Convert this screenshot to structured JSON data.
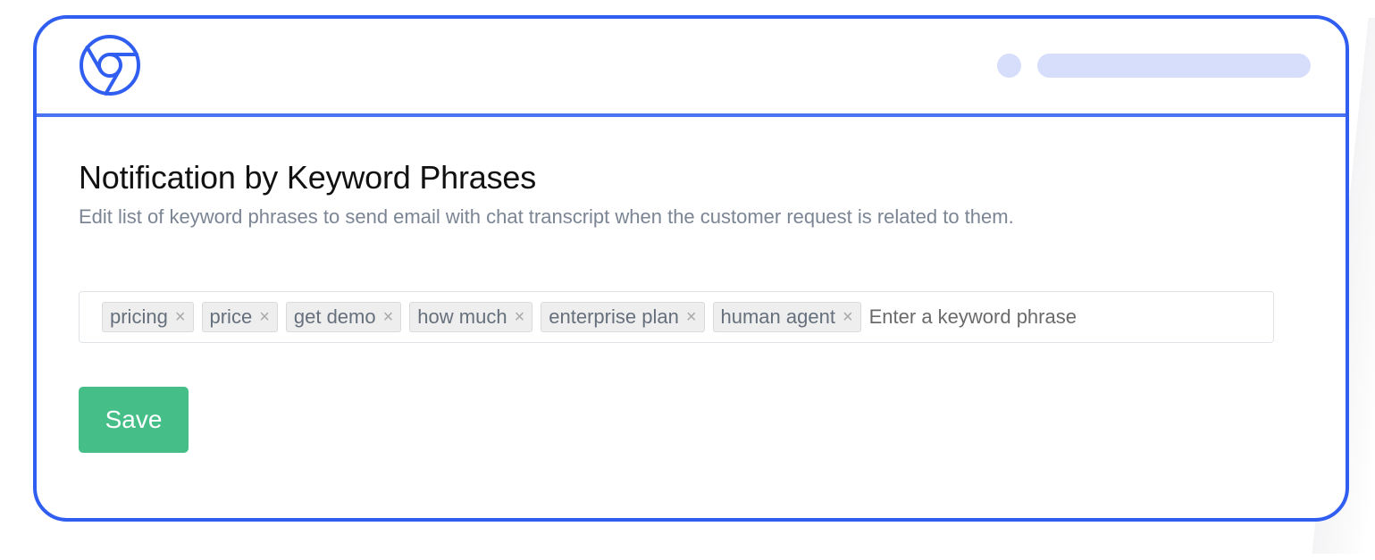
{
  "browser": {
    "logo_icon": "chrome-browser-icon",
    "colors": {
      "frame": "#2f5ef0",
      "divider": "#4a72f2",
      "placeholder_bars": "#d6defb"
    }
  },
  "page": {
    "title": "Notification by Keyword Phrases",
    "subtitle": "Edit list of keyword phrases to send email with chat transcript when the customer request is related to them."
  },
  "keywords": {
    "tags": [
      {
        "label": "pricing",
        "remove_icon": "×"
      },
      {
        "label": "price",
        "remove_icon": "×"
      },
      {
        "label": "get demo",
        "remove_icon": "×"
      },
      {
        "label": "how much",
        "remove_icon": "×"
      },
      {
        "label": "enterprise plan",
        "remove_icon": "×"
      },
      {
        "label": "human agent",
        "remove_icon": "×"
      }
    ],
    "input_value": "",
    "placeholder": "Enter a keyword phrase"
  },
  "actions": {
    "save_label": "Save",
    "save_color": "#45be88"
  }
}
